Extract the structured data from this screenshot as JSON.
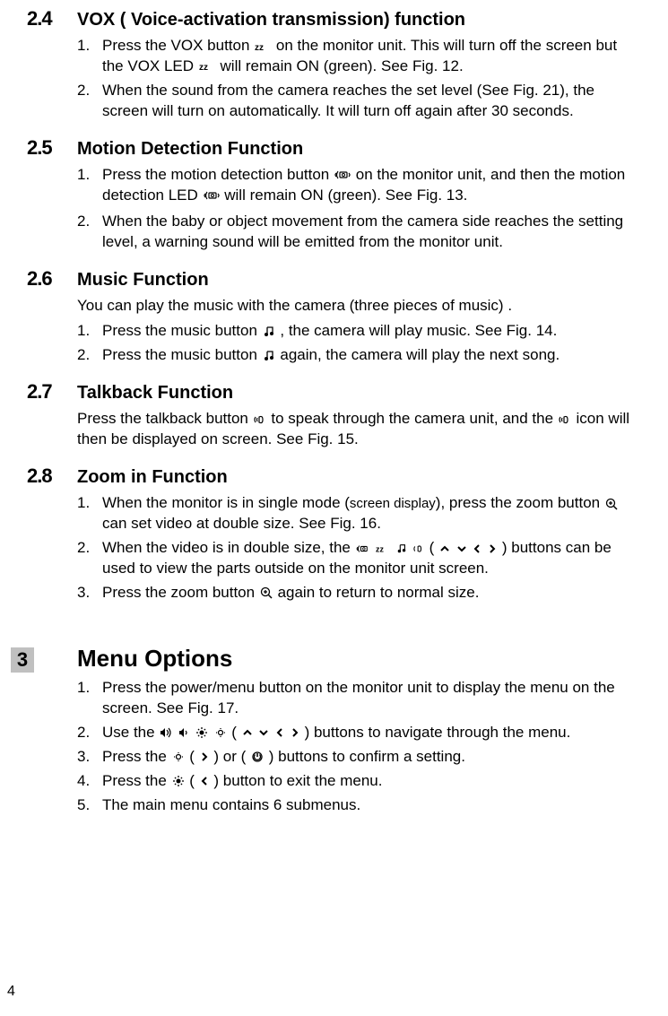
{
  "sections": {
    "s24": {
      "num": "2.4",
      "title": "VOX ( Voice-activation transmission) function",
      "items": [
        {
          "n": "1.",
          "pre": "Press the VOX button ",
          "mid": " on the monitor unit. This will turn off the screen but the VOX LED ",
          "post": " will remain ON (green).  See Fig. 12."
        },
        {
          "n": "2.",
          "text": "When the sound from the camera reaches the set level (See Fig. 21), the screen will turn on automatically.  It will turn off again after 30 seconds."
        }
      ]
    },
    "s25": {
      "num": "2.5",
      "title": "Motion Detection Function",
      "items": [
        {
          "n": "1.",
          "pre": "Press the motion detection button ",
          "mid": " on the monitor unit, and then the motion detection LED ",
          "post": " will remain ON (green). See Fig. 13."
        },
        {
          "n": "2.",
          "text": "When the baby or object movement from the camera side reaches the setting level, a warning sound will be emitted from the monitor unit."
        }
      ]
    },
    "s26": {
      "num": "2.6",
      "title": "Music Function",
      "intro": "You can play the music with the camera (three pieces of music) .",
      "items": [
        {
          "n": "1.",
          "pre": "Press the music button  ",
          "post": " , the camera will play music. See Fig. 14."
        },
        {
          "n": "2.",
          "pre": "Press the music button  ",
          "post": "  again, the camera will play the next song."
        }
      ]
    },
    "s27": {
      "num": "2.7",
      "title": "Talkback Function",
      "intro_pre": "Press the talkback button  ",
      "intro_mid": "  to speak through the camera unit, and the ",
      "intro_post": "   icon will then be displayed on screen. See Fig. 15."
    },
    "s28": {
      "num": "2.8",
      "title": "Zoom in Function",
      "items": [
        {
          "n": "1.",
          "pre": "When the monitor is in single mode (",
          "midsmall": "screen display",
          "mid2": "), press the zoom button ",
          "post": " can set video at double size. See Fig. 16."
        },
        {
          "n": "2.",
          "pre": "When the video is in double size, the ",
          "mid": " ( ",
          "post": " ) buttons can be used to view the parts outside on the monitor unit screen."
        },
        {
          "n": "3.",
          "pre": "Press the zoom button  ",
          "post": "   again to return to normal size."
        }
      ]
    },
    "s3": {
      "num": "3",
      "title": "Menu Options",
      "items": [
        {
          "n": "1.",
          "text": "Press the power/menu button on the monitor unit to display the menu on the screen. See Fig. 17."
        },
        {
          "n": "2.",
          "pre": "Use the  ",
          "mid": " ( ",
          "post": " ) buttons to navigate through the menu."
        },
        {
          "n": "3.",
          "pre": "Press the ",
          "mid": "  (   ",
          "mid2": "   ) or (  ",
          "post": "  ) buttons to confirm a setting."
        },
        {
          "n": "4.",
          "pre": "Press the  ",
          "mid": "  (   ",
          "post": "   ) button to exit the menu."
        },
        {
          "n": "5.",
          "text": "The main menu contains 6 submenus."
        }
      ]
    }
  },
  "pageNumber": "4"
}
